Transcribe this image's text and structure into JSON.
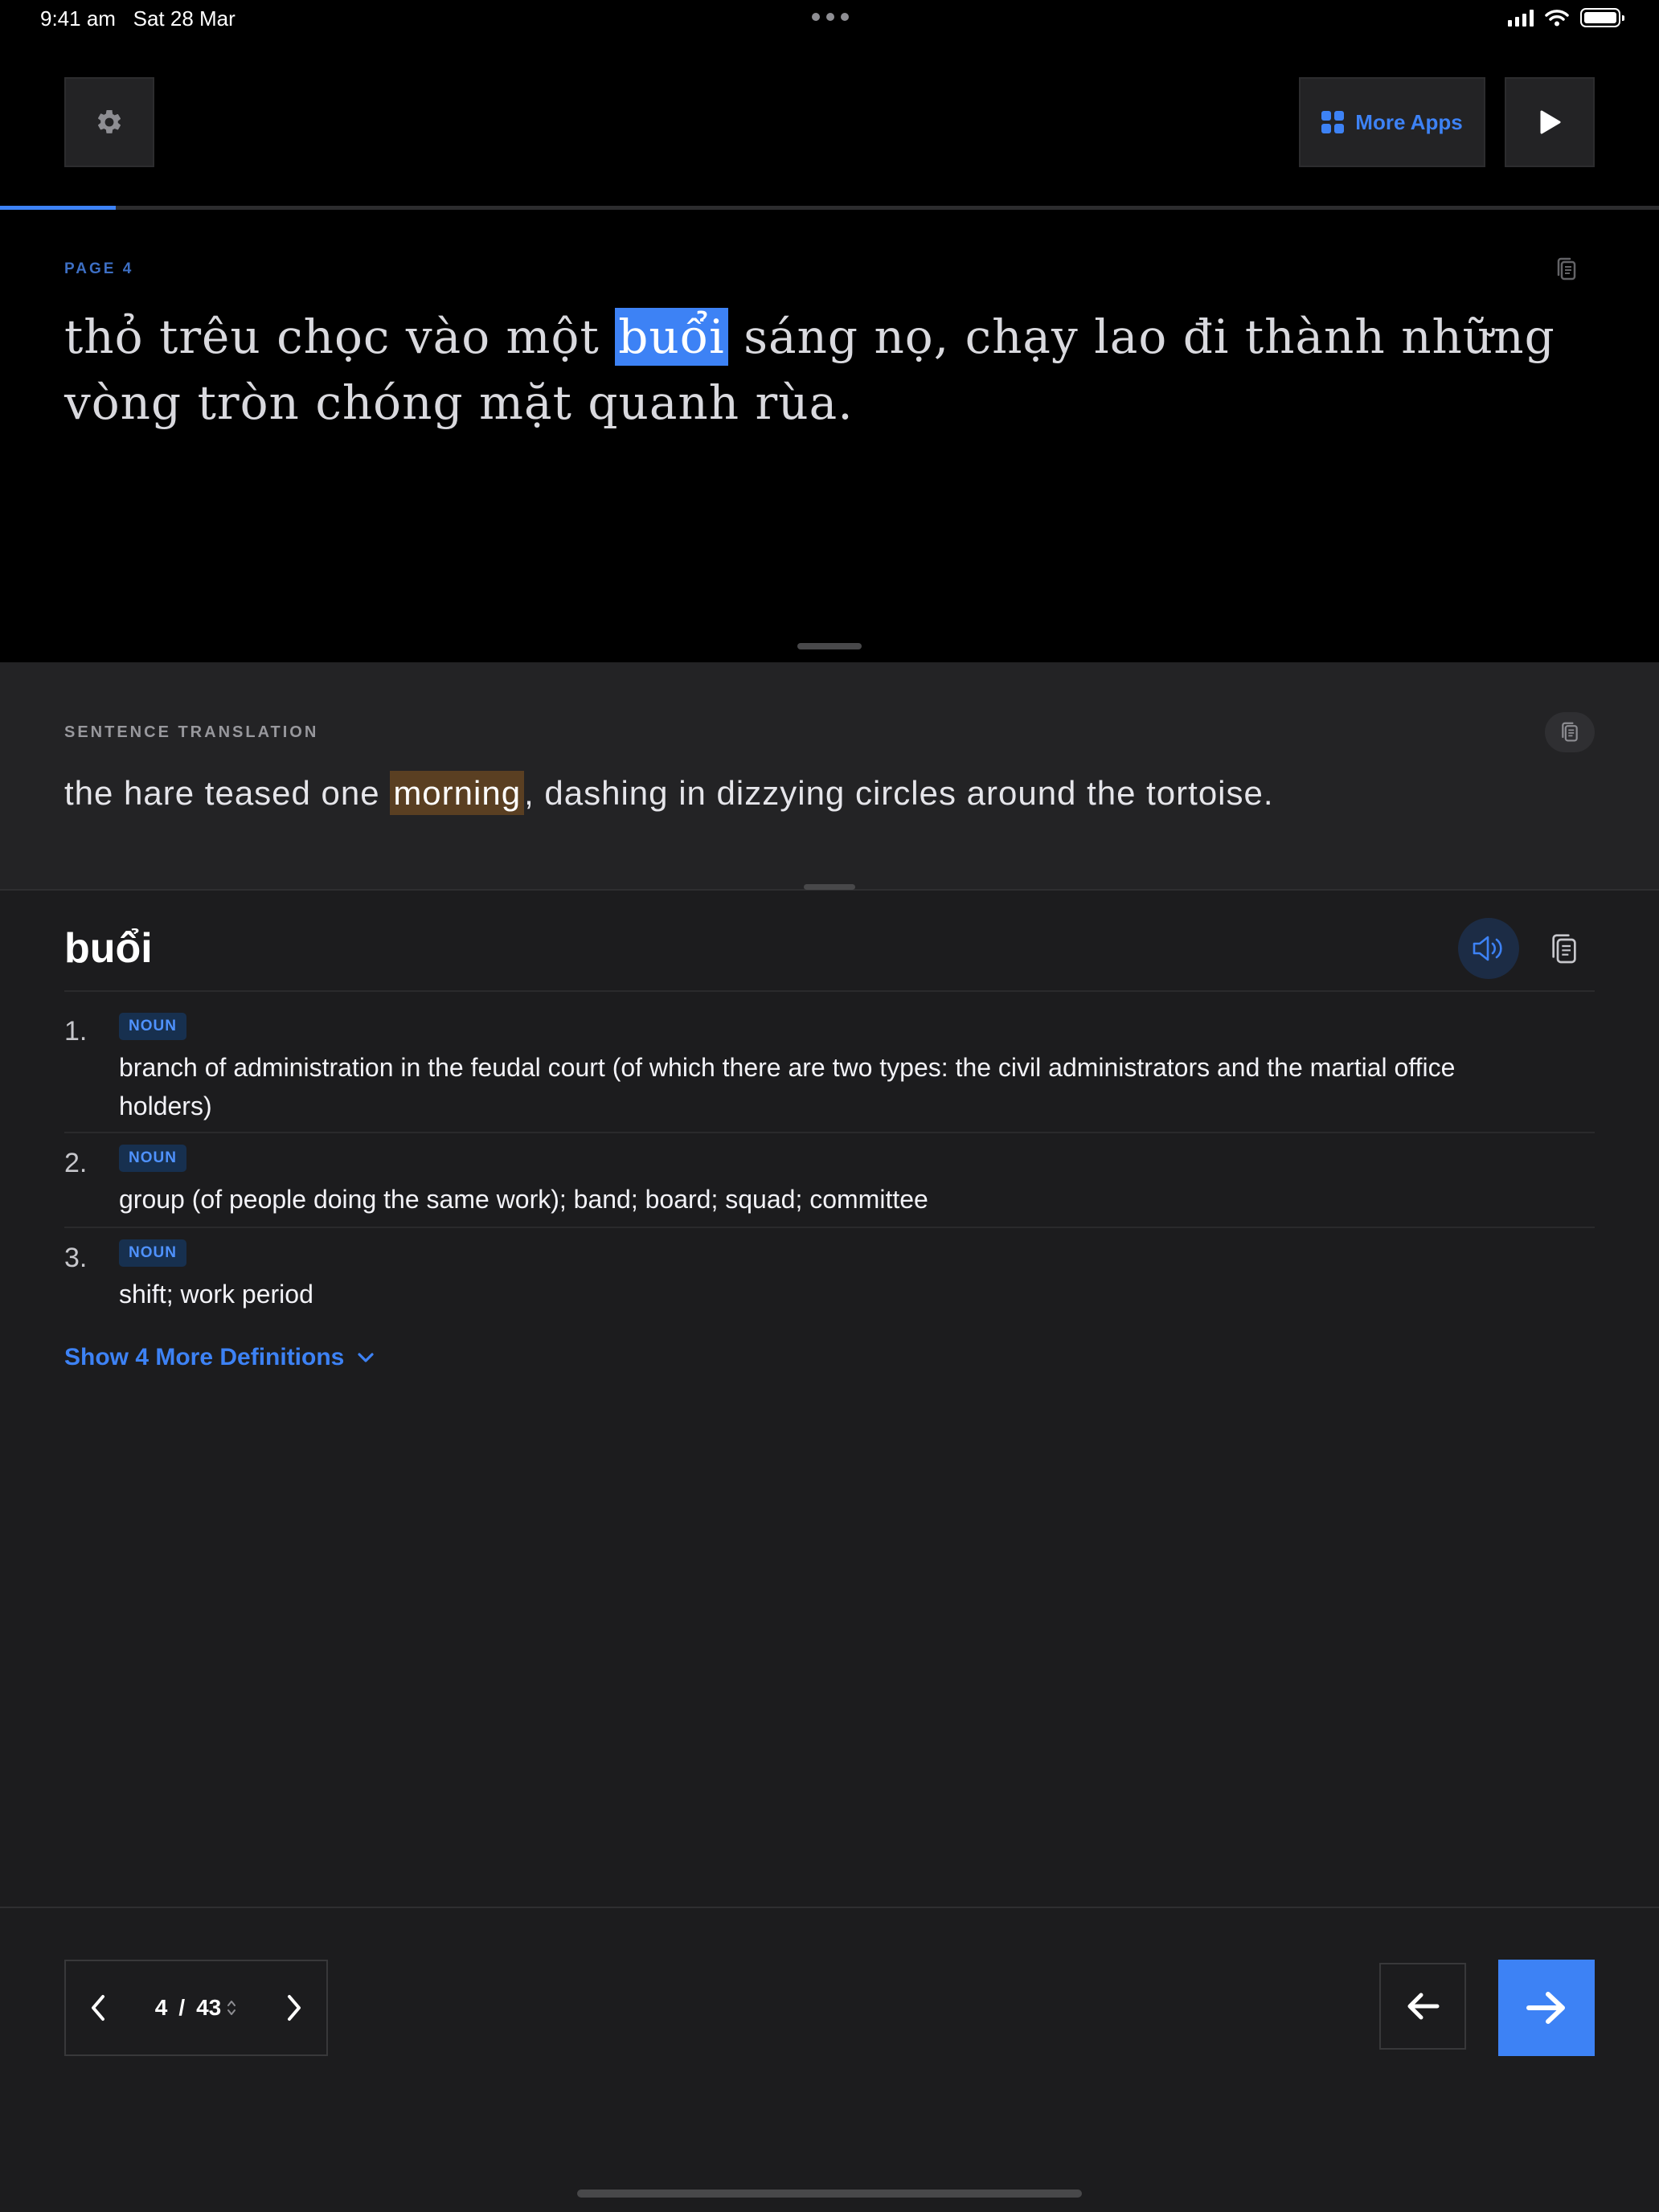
{
  "status_bar": {
    "time": "9:41 am",
    "date": "Sat 28 Mar"
  },
  "toolbar": {
    "more_apps_label": "More Apps"
  },
  "reader": {
    "progress_fraction": 0.07,
    "page_label": "PAGE 4",
    "passage_before": "thỏ trêu chọc vào một",
    "highlighted_word": "buổi",
    "passage_after": "sáng nọ, chạy lao đi thành những vòng tròn chóng mặt quanh rùa."
  },
  "translation": {
    "label": "SENTENCE TRANSLATION",
    "before": "the hare teased one",
    "highlight": "morning",
    "after": ", dashing in dizzying circles around the tortoise."
  },
  "dictionary": {
    "word": "buổi",
    "definitions": [
      {
        "num": "1.",
        "pos": "NOUN",
        "text": "branch of administration in the feudal court (of which there are two types: the civil administrators and the martial office holders)"
      },
      {
        "num": "2.",
        "pos": "NOUN",
        "text": "group (of people doing the same work); band; board; squad; committee"
      },
      {
        "num": "3.",
        "pos": "NOUN",
        "text": "shift; work period"
      }
    ],
    "show_more_label": "Show 4 More Definitions"
  },
  "pager": {
    "current": "4",
    "separator": "/",
    "total": "43"
  },
  "colors": {
    "accent": "#3d82f5",
    "translation_highlight": "#5a3f22",
    "background": "#1c1c1e"
  }
}
